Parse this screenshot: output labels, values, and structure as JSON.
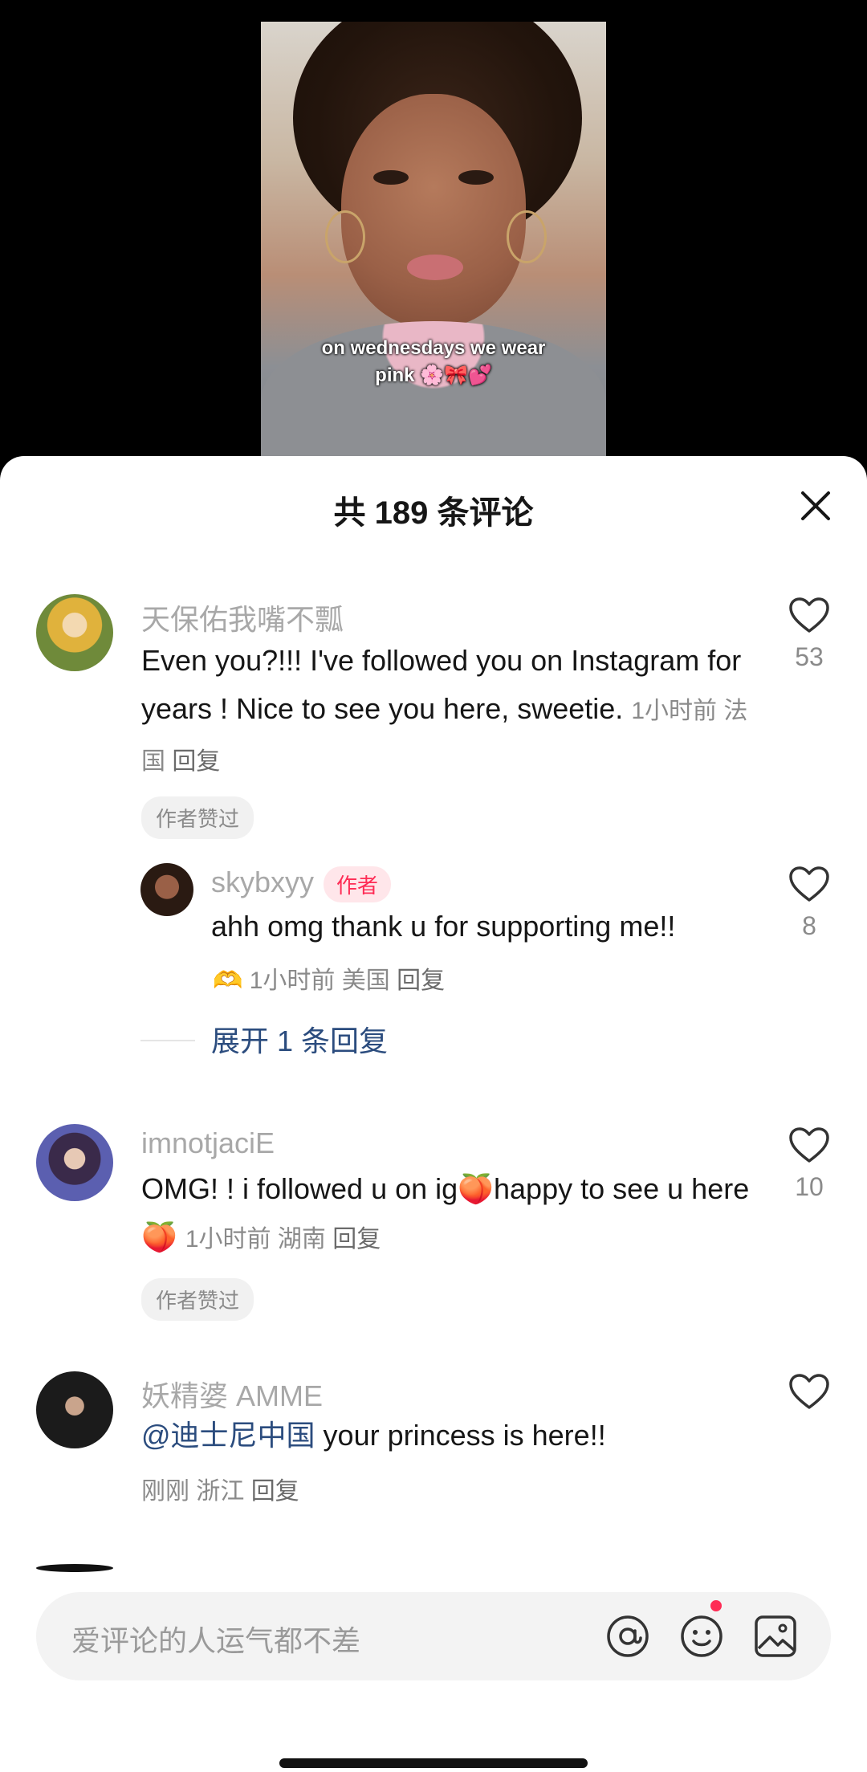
{
  "video": {
    "caption": "on wednesdays we wear pink 🌸🎀💕"
  },
  "sheet": {
    "title": "共 189 条评论"
  },
  "comments": [
    {
      "user": "天保佑我嘴不瓢",
      "text": "Even you?!!! I've followed you on Instagram for years ! Nice to see you here, sweetie.",
      "time": "1小时前",
      "location": "法国",
      "reply": "回复",
      "likes": "53",
      "badge": "作者赞过"
    },
    {
      "user": "skybxyy",
      "author_tag": "作者",
      "text": "ahh omg thank u for supporting me!!",
      "emoji": "🫶",
      "time": "1小时前",
      "location": "美国",
      "reply": "回复",
      "likes": "8",
      "expand": "展开 1 条回复"
    },
    {
      "user": "imnotjaciE",
      "text_a": "OMG! !  i followed u on ig",
      "text_b": "happy to see u here",
      "time": "1小时前",
      "location": "湖南",
      "reply": "回复",
      "likes": "10",
      "badge": "作者赞过"
    },
    {
      "user": "妖精婆 AMME",
      "mention": "@迪士尼中国",
      "text": " your princess is here!!",
      "time": "刚刚",
      "location": "浙江",
      "reply": "回复",
      "likes": ""
    }
  ],
  "input": {
    "placeholder": "爱评论的人运气都不差"
  },
  "icons": {
    "close": "close-icon",
    "heart": "heart-icon",
    "at": "at-icon",
    "emoji": "emoji-icon",
    "image": "image-icon"
  },
  "colors": {
    "accent": "#fe2c55",
    "link": "#2b4c7e"
  }
}
